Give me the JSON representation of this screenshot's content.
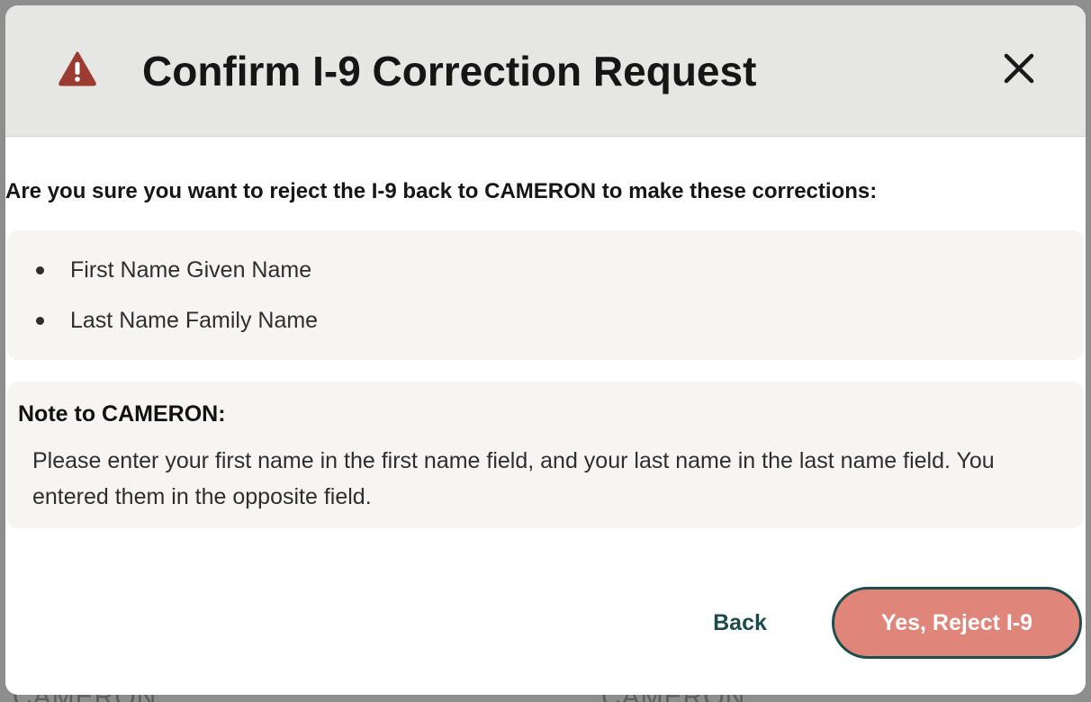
{
  "background": {
    "left_text": "CAMERON",
    "right_text": "CAMERON"
  },
  "dialog": {
    "title": "Confirm I-9 Correction Request",
    "warning_icon": "warning-triangle-icon",
    "close_icon": "close-icon",
    "prompt": "Are you sure you want to reject the I-9 back to CAMERON to make these corrections:",
    "corrections": [
      "First Name Given Name",
      "Last Name Family Name"
    ],
    "note_heading": "Note to CAMERON:",
    "note_body": "Please enter your first name in the first name field, and your last name in the last name field. You entered them in the opposite field.",
    "back_label": "Back",
    "confirm_label": "Yes, Reject I-9"
  },
  "colors": {
    "warning": "#9b3b32",
    "header_bg": "#e6e6e4",
    "panel_bg": "#f7f5f2",
    "confirm_bg": "#e0857a",
    "accent_dark": "#1f4d4d"
  }
}
